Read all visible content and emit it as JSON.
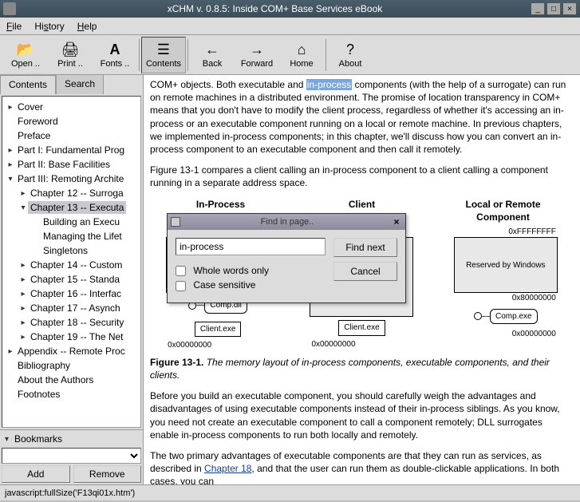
{
  "window": {
    "title": "xCHM v. 0.8.5: Inside COM+ Base Services eBook"
  },
  "menu": {
    "file": "File",
    "history": "History",
    "help": "Help"
  },
  "toolbar": {
    "open": "Open ..",
    "print": "Print ..",
    "fonts": "Fonts ..",
    "contents": "Contents",
    "back": "Back",
    "forward": "Forward",
    "home": "Home",
    "about": "About"
  },
  "side_tabs": {
    "contents": "Contents",
    "search": "Search"
  },
  "tree": [
    {
      "level": 0,
      "exp": "▸",
      "label": "Cover"
    },
    {
      "level": 0,
      "exp": "",
      "label": "Foreword"
    },
    {
      "level": 0,
      "exp": "",
      "label": "Preface"
    },
    {
      "level": 0,
      "exp": "▸",
      "label": "Part I: Fundamental Prog"
    },
    {
      "level": 0,
      "exp": "▸",
      "label": "Part II: Base Facilities"
    },
    {
      "level": 0,
      "exp": "▾",
      "label": "Part III: Remoting Archite"
    },
    {
      "level": 1,
      "exp": "▸",
      "label": "Chapter 12 -- Surroga"
    },
    {
      "level": 1,
      "exp": "▾",
      "label": "Chapter 13 -- Executa",
      "selected": true
    },
    {
      "level": 2,
      "exp": "",
      "label": "Building an Execu"
    },
    {
      "level": 2,
      "exp": "",
      "label": "Managing the Lifet"
    },
    {
      "level": 2,
      "exp": "",
      "label": "Singletons"
    },
    {
      "level": 1,
      "exp": "▸",
      "label": "Chapter 14 -- Custom"
    },
    {
      "level": 1,
      "exp": "▸",
      "label": "Chapter 15 -- Standa"
    },
    {
      "level": 1,
      "exp": "▸",
      "label": "Chapter 16 -- Interfac"
    },
    {
      "level": 1,
      "exp": "▸",
      "label": "Chapter 17 -- Asynch"
    },
    {
      "level": 1,
      "exp": "▸",
      "label": "Chapter 18 -- Security"
    },
    {
      "level": 1,
      "exp": "▸",
      "label": "Chapter 19 -- The Net"
    },
    {
      "level": 0,
      "exp": "▸",
      "label": "Appendix -- Remote Proc"
    },
    {
      "level": 0,
      "exp": "",
      "label": "Bibliography"
    },
    {
      "level": 0,
      "exp": "",
      "label": "About the Authors"
    },
    {
      "level": 0,
      "exp": "",
      "label": "Footnotes"
    }
  ],
  "bookmarks": {
    "label": "Bookmarks",
    "add": "Add",
    "remove": "Remove"
  },
  "content": {
    "p1a": "COM+ objects. Both executable and ",
    "p1_hl": "in-process",
    "p1b": " components (with the help of a surrogate) can run on remote machines in a distributed environment. The promise of location transparency in COM+ means that you don't have to modify the client process, regardless of whether it's accessing an in-process or an executable component running on a local or remote machine. In previous chapters, we implemented in-process components; in this chapter, we'll discuss how you can convert an in-process component to an executable component and then call it remotely.",
    "p2": "Figure 13-1 compares a client calling an in-process component to a client calling a component running in a separate address space.",
    "fig": {
      "h1": "In-Process Component",
      "h2": "Client",
      "h3": "Local or Remote Component",
      "addr_top": "0xFFFFFFFF",
      "addr_mid": "0x80000000",
      "addr_bot": "0x00000000",
      "reserved": "Reserved by Windows",
      "compdll": "Comp.dll",
      "clientexe": "Client.exe",
      "compexe": "Comp.exe",
      "caption_b": "Figure 13-1.",
      "caption_i": "The memory layout of in-process components, executable components, and their clients."
    },
    "p3": "Before you build an executable component, you should carefully weigh the advantages and disadvantages of using executable components instead of their in-process siblings. As you know, you need not create an executable component to call a component remotely; DLL surrogates enable in-process components to run both locally and remotely.",
    "p4a": "The two primary advantages of executable components are that they can run as services, as described in ",
    "p4_link": "Chapter 18",
    "p4b": ", and that the user can run them as double-clickable applications. In both cases, you can"
  },
  "dialog": {
    "title": "Find in page..",
    "value": "in-process",
    "whole": "Whole words only",
    "case": "Case sensitive",
    "findnext": "Find next",
    "cancel": "Cancel"
  },
  "status": "javascript:fullSize('F13qi01x.htm')"
}
